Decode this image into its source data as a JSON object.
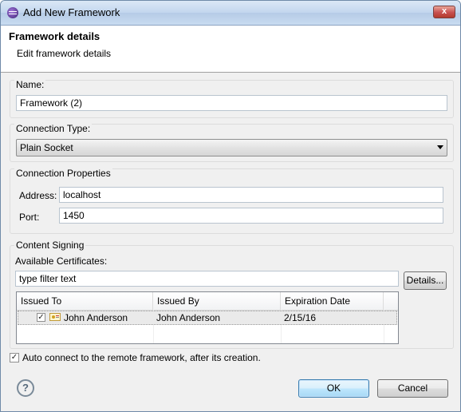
{
  "window": {
    "title": "Add New Framework",
    "close_label": "x"
  },
  "header": {
    "title": "Framework details",
    "subtitle": "Edit framework details"
  },
  "name_group": {
    "label": "Name:",
    "value": "Framework (2)"
  },
  "connection_type": {
    "label": "Connection Type:",
    "selected": "Plain Socket"
  },
  "connection_properties": {
    "label": "Connection Properties",
    "address_label": "Address:",
    "address_value": "localhost",
    "port_label": "Port:",
    "port_value": "1450"
  },
  "content_signing": {
    "label": "Content Signing",
    "available_label": "Available Certificates:",
    "filter_text": "type filter text",
    "details_button": "Details...",
    "columns": [
      "Issued To",
      "Issued By",
      "Expiration Date"
    ],
    "rows": [
      {
        "checked": true,
        "issued_to": "John Anderson",
        "issued_by": "John Anderson",
        "expiration": "2/15/16"
      }
    ]
  },
  "auto_connect": {
    "checked": true,
    "label": "Auto connect to the remote framework, after its creation."
  },
  "footer": {
    "help_icon": "?",
    "ok_label": "OK",
    "cancel_label": "Cancel"
  }
}
